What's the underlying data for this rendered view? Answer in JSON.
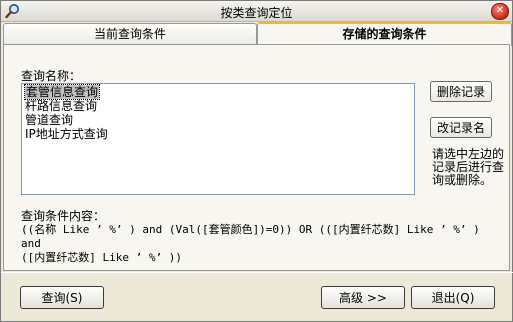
{
  "window": {
    "title": "按类查询定位",
    "close_symbol": "✕"
  },
  "tabs": [
    {
      "label": "当前查询条件"
    },
    {
      "label": "存储的查询条件"
    }
  ],
  "panel": {
    "query_name_label": "查询名称：",
    "saved_queries": [
      "套管信息查询",
      "杆路信息查询",
      "管道查询",
      "IP地址方式查询"
    ],
    "selected_index": 0,
    "delete_button": "删除记录",
    "rename_button": "改记录名",
    "hint": "请选中左边的记录后进行查询或删除。",
    "content_label": "查询条件内容：",
    "content_text": "((名称 Like ’ %’ ) and (Val([套管颜色])=0)) OR (([内置纤芯数] Like ’ %’ ) and\n([内置纤芯数] Like ’ %’ ))"
  },
  "footer": {
    "query_button": "查询(S)",
    "advanced_button": "高级 >>",
    "exit_button": "退出(Q)"
  },
  "colors": {
    "tab_accent": "#f0b838",
    "close_red": "#c8281a",
    "window_bg": "#ece9d8"
  },
  "icons": {
    "app": "search-magnifier-icon",
    "close": "close-icon"
  }
}
